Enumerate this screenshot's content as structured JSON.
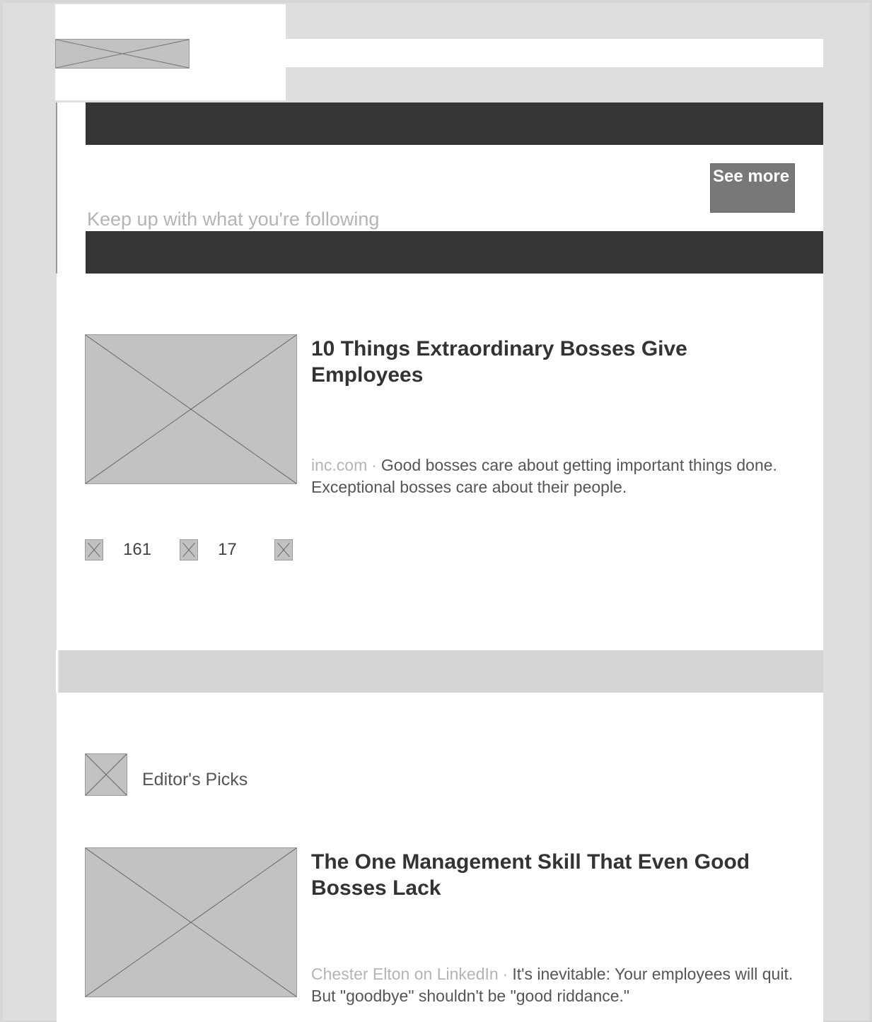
{
  "header": {
    "logo_icon": "logo-image-placeholder"
  },
  "following": {
    "see_more_label": "See more",
    "subtitle": "Keep up with what you're following"
  },
  "articles": [
    {
      "title": "10 Things Extraordinary Bosses Give Employees",
      "source": "inc.com",
      "separator": "·",
      "description": "Good bosses care about getting important things done. Exceptional bosses care about their people.",
      "likes": "161",
      "comments": "17"
    },
    {
      "title": "The One Management Skill That Even Good Bosses Lack",
      "source": "Chester Elton on LinkedIn",
      "separator": "·",
      "description": "It's inevitable: Your employees will quit. But \"goodbye\" shouldn't be \"good riddance.\""
    }
  ],
  "editors_picks": {
    "label": "Editor's Picks"
  },
  "colors": {
    "background": "#d6d6d6",
    "card": "#ffffff",
    "dark_bar": "#353535",
    "button": "#787878",
    "placeholder": "#c2c2c2"
  }
}
